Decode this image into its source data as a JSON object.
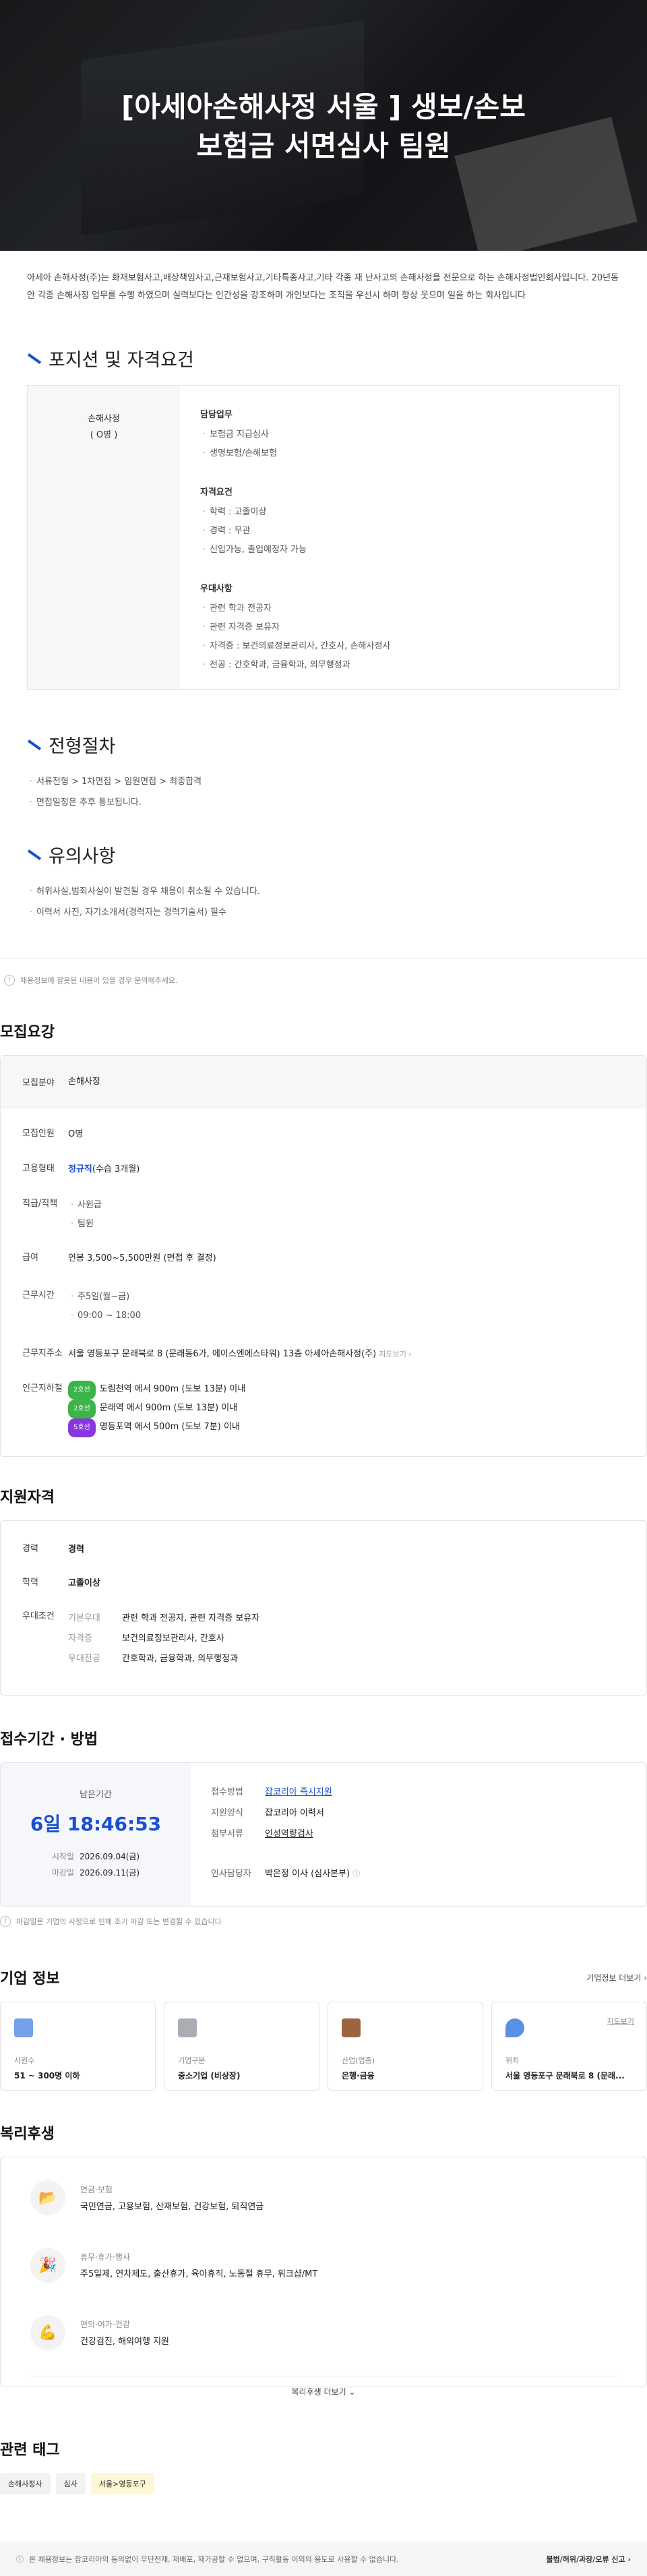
{
  "hero": {
    "title_line1": "[아세아손해사정 서울 ] 생보/손보",
    "title_line2": "보험금 서면심사 팀원"
  },
  "intro": "아세아 손해사정(주)는 화재보험사고,배상책임사고,근재보험사고,기타특종사고,기타 각종 재 난사고의 손해사정을 전문으로 하는 손해사정법인회사입니다. 20년동안 각종 손해사정 업무를 수행 하였으며 실력보다는 인간성을 강조하며 개인보다는 조직을 우선시 하며 항상 웃으며 일을 하는 회사입니다",
  "position": {
    "title": "포지션 및 자격요건",
    "left": {
      "name": "손해사정",
      "count": "( O명 )"
    },
    "groups": [
      {
        "title": "담당업무",
        "items": [
          "보험금 지급심사",
          "생명보험/손해보험"
        ]
      },
      {
        "title": "자격요건",
        "items": [
          "학력 : 고졸이상",
          "경력 : 무관",
          "신입가능, 졸업예정자 가능"
        ]
      },
      {
        "title": "우대사항",
        "items": [
          "관련 학과 전공자",
          "관련 자격증 보유자",
          "자격증 : 보건의료정보관리사, 간호사, 손해사정사",
          "전공 : 간호학과, 금융학과, 의무행정과"
        ]
      }
    ]
  },
  "process": {
    "title": "전형절차",
    "items": [
      "서류전형 > 1차면접 > 임원면접 > 최종합격",
      "면접일정은 추후 통보됩니다."
    ]
  },
  "caution": {
    "title": "유의사항",
    "items": [
      "허위사실,범죄사실이 발견될 경우 채용이 취소될 수 있습니다.",
      "이력서 사진, 자기소개서(경력자는 경력기술서) 필수"
    ]
  },
  "notice1": "채용정보에 잘못된 내용이 있을 경우 문의해주세요.",
  "recruit": {
    "title": "모집요강",
    "field_label": "모집분야",
    "field_value": "손해사정",
    "people_label": "모집인원",
    "people_value": "O명",
    "employ_label": "고용형태",
    "employ_value": "정규직",
    "employ_sub": "(수습 3개월)",
    "rank_label": "직급/직책",
    "rank_values": [
      "사원급",
      "팀원"
    ],
    "salary_label": "급여",
    "salary_value": "연봉 3,500~5,500만원 (면접 후 결정)",
    "time_label": "근무시간",
    "time_values": [
      "주5일(월~금)",
      "09:00 ~ 18:00"
    ],
    "addr_label": "근무지주소",
    "addr_value": "서울 영등포구 문래북로 8 (문래동6가, 에이스엔에스타워) 13층 아세아손해사정(주)",
    "map_link": "지도보기 ›",
    "station_label": "인근지하철",
    "stations": [
      {
        "line": "2호선",
        "color": "#3cb44a",
        "text": "도림천역 에서 900m (도보 13분) 이내"
      },
      {
        "line": "2호선",
        "color": "#3cb44a",
        "text": "문래역 에서 900m (도보 13분) 이내"
      },
      {
        "line": "5호선",
        "color": "#8936e0",
        "text": "영등포역 에서 500m (도보 7분) 이내"
      }
    ]
  },
  "qualif": {
    "title": "지원자격",
    "career_label": "경력",
    "career_value": "경력",
    "edu_label": "학력",
    "edu_value": "고졸이상",
    "pref_label": "우대조건",
    "prefs": [
      {
        "k": "기본우대",
        "v": "관련 학과 전공자, 관련 자격증 보유자"
      },
      {
        "k": "자격증",
        "v": "보건의료정보관리사, 간호사"
      },
      {
        "k": "우대전공",
        "v": "간호학과, 금융학과, 의무행정과"
      }
    ]
  },
  "apply": {
    "title": "접수기간 · 방법",
    "remain_label": "남은기간",
    "remain_value": "6일 18:46:53",
    "start_label": "시작일",
    "start_value": "2026.09.04(금)",
    "end_label": "마감일",
    "end_value": "2026.09.11(금)",
    "method_label": "접수방법",
    "method_value": "잡코리아 즉시지원",
    "form_label": "지원양식",
    "form_value": "잡코리아 이력서",
    "doc_label": "첨부서류",
    "doc_value": "인성역량검사",
    "manager_label": "인사담당자",
    "manager_value": "박은정 이사 (심사본부)",
    "notice": "마감일은 기업의 사정으로 인해 조기 마감 또는 변경될 수 있습니다"
  },
  "company": {
    "title": "기업 정보",
    "more": "기업정보 더보기 ›",
    "map": "지도보기",
    "cards": [
      {
        "label": "사원수",
        "value": "51 ~ 300명 이하",
        "color": "#5a8ee8"
      },
      {
        "label": "기업구분",
        "value": "중소기업 (비상장)",
        "color": "#9aa0a8"
      },
      {
        "label": "산업(업종)",
        "value": "은행·금융",
        "color": "#8b4a1f"
      },
      {
        "label": "위치",
        "value": "서울 영등포구 문래북로 8 (문래...",
        "color": "#3a7de0"
      }
    ]
  },
  "welfare": {
    "title": "복리후생",
    "rows": [
      {
        "cat": "연금·보험",
        "val": "국민연금, 고용보험, 산재보험, 건강보험, 퇴직연금",
        "icon": "📂"
      },
      {
        "cat": "휴무·휴가·행사",
        "val": "주5일제, 연차제도, 출산휴가, 육아휴직, 노동절 휴무, 워크샵/MT",
        "icon": "🎉"
      },
      {
        "cat": "편의·여가·건강",
        "val": "건강검진, 해외여행 지원",
        "icon": "💪"
      }
    ],
    "more": "복리후생 더보기 ⌄"
  },
  "tags": {
    "title": "관련 태그",
    "items": [
      "손해사정사",
      "심사",
      "서울>영등포구"
    ]
  },
  "footer": {
    "text": "본 채용정보는 잡코리아의 동의없이 무단전재, 재배포, 재가공할 수 없으며, 구직활동 이외의 용도로 사용할 수 없습니다.",
    "report": "불법/허위/과장/오류 신고 ›"
  }
}
